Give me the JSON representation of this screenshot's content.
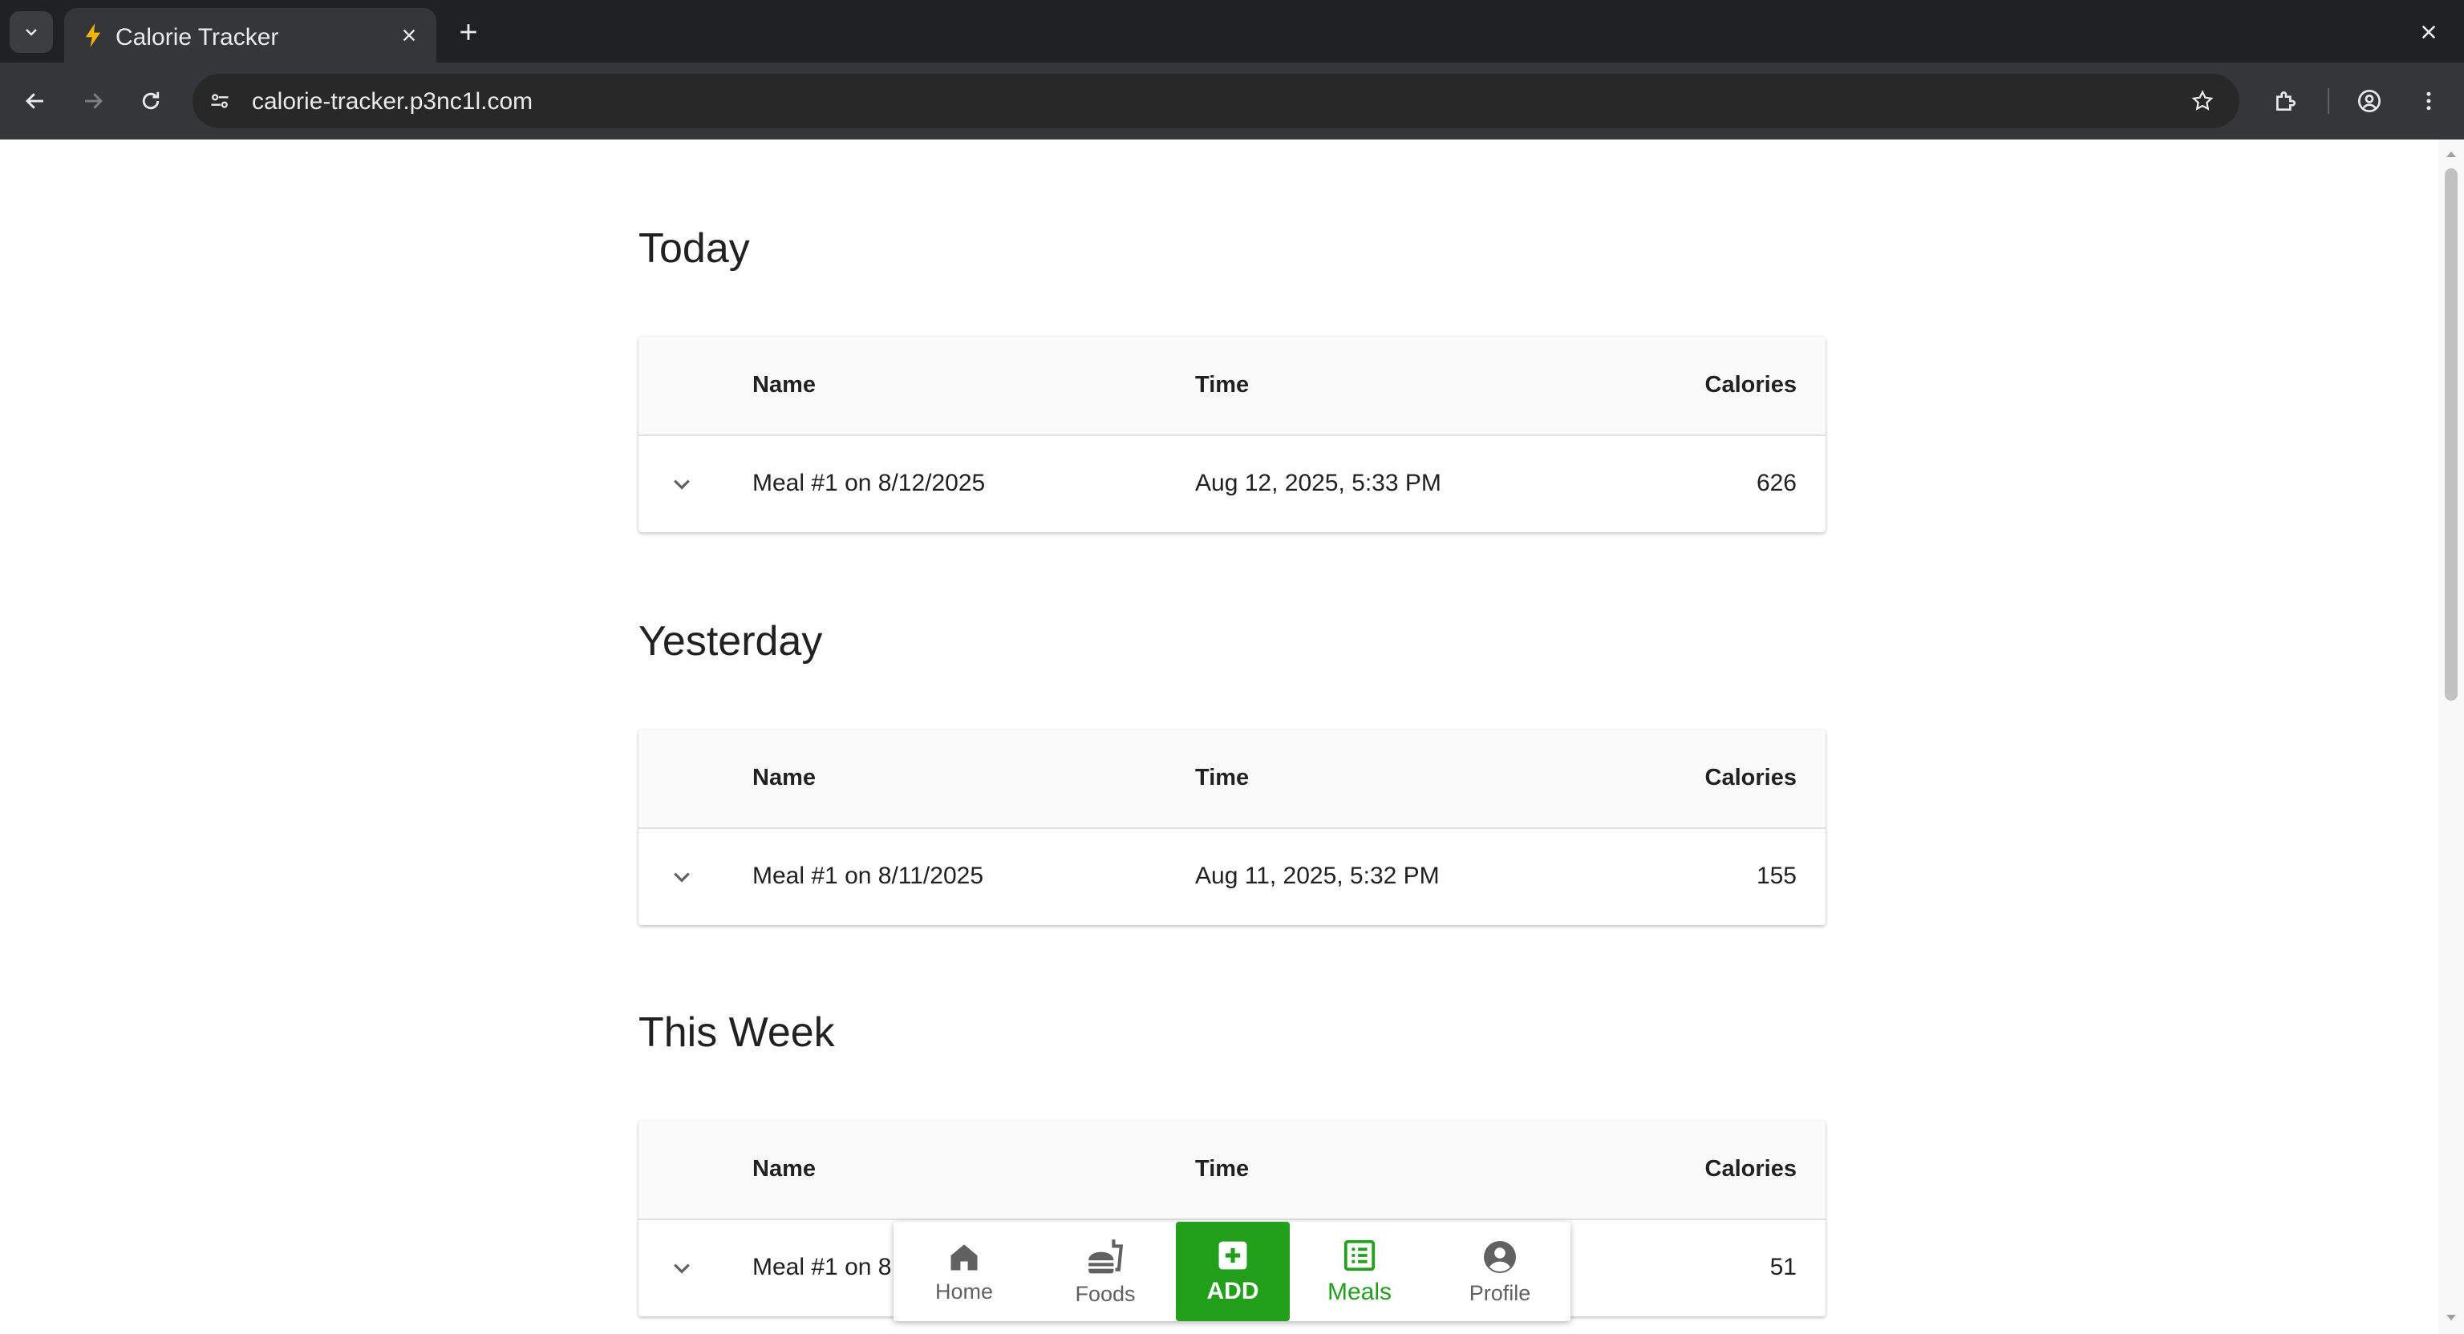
{
  "browser": {
    "tab_title": "Calorie Tracker",
    "url": "calorie-tracker.p3nc1l.com"
  },
  "sections": [
    {
      "title": "Today",
      "headers": {
        "name": "Name",
        "time": "Time",
        "calories": "Calories"
      },
      "row": {
        "name": "Meal #1 on 8/12/2025",
        "time": "Aug 12, 2025, 5:33 PM",
        "calories": "626"
      }
    },
    {
      "title": "Yesterday",
      "headers": {
        "name": "Name",
        "time": "Time",
        "calories": "Calories"
      },
      "row": {
        "name": "Meal #1 on 8/11/2025",
        "time": "Aug 11, 2025, 5:32 PM",
        "calories": "155"
      }
    },
    {
      "title": "This Week",
      "headers": {
        "name": "Name",
        "time": "Time",
        "calories": "Calories"
      },
      "row": {
        "name": "Meal #1 on 8",
        "time": "",
        "calories": "51"
      }
    }
  ],
  "bottom_nav": {
    "home": "Home",
    "foods": "Foods",
    "add": "ADD",
    "meals": "Meals",
    "profile": "Profile",
    "active": "meals"
  },
  "colors": {
    "accent": "#22a01c",
    "chrome_dark": "#202124",
    "chrome_toolbar": "#35363a"
  }
}
